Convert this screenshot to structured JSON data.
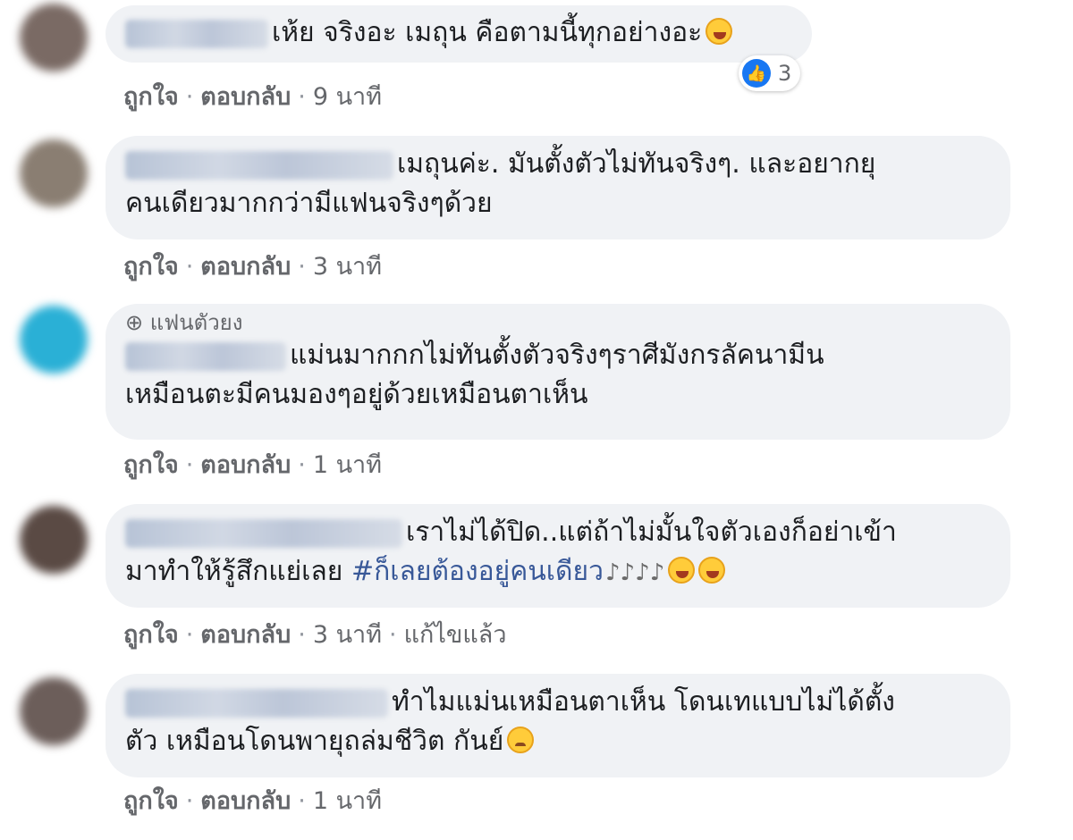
{
  "actions": {
    "like": "ถูกใจ",
    "reply": "ตอบกลับ",
    "separator": "·",
    "edited": "แก้ไขแล้ว"
  },
  "comments": [
    {
      "text": "เห้ย จริงอะ เมถุน คือตามนี้ทุกอย่างอะ",
      "time": "9 นาที",
      "reaction_count": "3",
      "avatar_color": "#7a6a64"
    },
    {
      "text": "เมถุนค่ะ. มันตั้งตัวไม่ทันจริงๆ. และอยากยุ คนเดียวมากกว่ามีแฟนจริงๆด้วย",
      "line1": "เมถุนค่ะ. มันตั้งตัวไม่ทันจริงๆ. และอยากยุ",
      "line2": "คนเดียวมากกว่ามีแฟนจริงๆด้วย",
      "time": "3 นาที",
      "avatar_color": "#8a7e72"
    },
    {
      "badge": "แฟนตัวยง",
      "line1": "แม่นมากกกไม่ทันตั้งตัวจริงๆราศีมังกรลัคนามีน",
      "line2": "เหมือนตะมีคนมองๆอยู่ด้วยเหมือนตาเห็น",
      "time": "1 นาที",
      "avatar_color": "#2ab0d6"
    },
    {
      "line1": "เราไม่ได้ปิด..แต่ถ้าไม่มั้นใจตัวเองก็อย่าเข้า",
      "line2_text": "มาทำให้รู้สึกแย่เลย",
      "hashtag": "#ก็เลยต้องอยู่คนเดียว",
      "music": "♪♪♪♪",
      "time": "3 นาที",
      "avatar_color": "#5a4a44"
    },
    {
      "line1": "ทำไมแม่นเหมือนตาเห็น โดนเทแบบไม่ได้ตั้ง",
      "line2": "ตัว เหมือนโดนพายุถล่มชีวิต กันย์",
      "time": "1 นาที",
      "avatar_color": "#6c5e5a"
    }
  ],
  "colors": {
    "bubble": "#f0f2f5",
    "action_text": "#65676b",
    "hashtag": "#385898",
    "like_blue": "#1877f2"
  },
  "icons": {
    "like": "thumbs-up-icon",
    "laugh": "laughing-tears-emoji",
    "cry": "crying-emoji",
    "music": "music-note-icon",
    "globe": "globe-icon"
  }
}
